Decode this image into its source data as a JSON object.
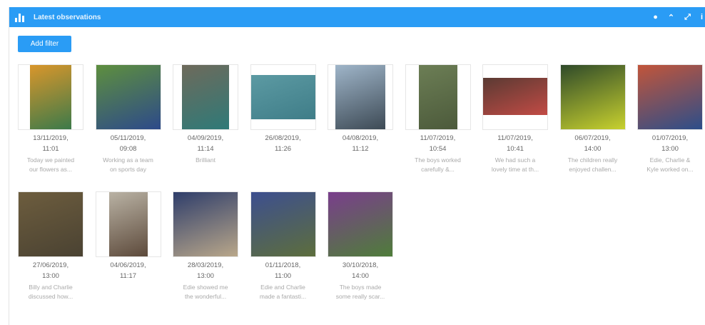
{
  "widget": {
    "title": "Latest observations",
    "icon": "bar-chart-icon",
    "tools": [
      {
        "name": "settings-icon",
        "glyph": "●"
      },
      {
        "name": "collapse-icon",
        "glyph": "⌃"
      },
      {
        "name": "expand-icon",
        "glyph": "⤢"
      },
      {
        "name": "info-icon",
        "glyph": "i"
      }
    ]
  },
  "filter_button": "Add filter",
  "observations": [
    {
      "date": "13/11/2019,",
      "time": "11:01",
      "caption": [
        "Today we painted",
        "our flowers as..."
      ],
      "colors": [
        "#d9962b",
        "#3c7a4a"
      ]
    },
    {
      "date": "05/11/2019,",
      "time": "09:08",
      "caption": [
        "Working as a team",
        "on sports day"
      ],
      "colors": [
        "#5e8f3e",
        "#2d4a8a"
      ]
    },
    {
      "date": "04/09/2019,",
      "time": "11:14",
      "caption": [
        "Brilliant"
      ],
      "colors": [
        "#6e6a5b",
        "#2f7a78"
      ]
    },
    {
      "date": "26/08/2019,",
      "time": "11:26",
      "caption": [],
      "colors": [
        "#5c9aa3",
        "#3f7d88"
      ]
    },
    {
      "date": "04/08/2019,",
      "time": "11:12",
      "caption": [],
      "colors": [
        "#9fb5c9",
        "#3d4a55"
      ]
    },
    {
      "date": "11/07/2019,",
      "time": "10:54",
      "caption": [
        "The boys worked",
        "carefully &..."
      ],
      "colors": [
        "#6c7e55",
        "#4c5a3b"
      ]
    },
    {
      "date": "11/07/2019,",
      "time": "10:41",
      "caption": [
        "We had such a",
        "lovely time at th..."
      ],
      "colors": [
        "#5a3a33",
        "#c24b45"
      ]
    },
    {
      "date": "06/07/2019,",
      "time": "14:00",
      "caption": [
        "The children really",
        "enjoyed challen..."
      ],
      "colors": [
        "#2f4a2a",
        "#c8d12e"
      ]
    },
    {
      "date": "01/07/2019,",
      "time": "13:00",
      "caption": [
        "Edie, Charlie &",
        "Kyle worked on..."
      ],
      "colors": [
        "#c2553a",
        "#2c4e8a"
      ]
    },
    {
      "date": "27/06/2019,",
      "time": "13:00",
      "caption": [
        "Billy and Charlie",
        "discussed how..."
      ],
      "colors": [
        "#6d5d3e",
        "#4a4232"
      ]
    },
    {
      "date": "04/06/2019,",
      "time": "11:17",
      "caption": [],
      "colors": [
        "#b9b2a4",
        "#5d4a3b"
      ]
    },
    {
      "date": "28/03/2019,",
      "time": "13:00",
      "caption": [
        "Edie showed me",
        "the wonderful..."
      ],
      "colors": [
        "#2f3e6b",
        "#b9a78a"
      ]
    },
    {
      "date": "01/11/2018,",
      "time": "11:00",
      "caption": [
        "Edie and Charlie",
        "made a fantasti..."
      ],
      "colors": [
        "#3d4f8f",
        "#5d6e3c"
      ]
    },
    {
      "date": "30/10/2018,",
      "time": "14:00",
      "caption": [
        "The boys made",
        "some really scar..."
      ],
      "colors": [
        "#7a3e8c",
        "#4f7d3a"
      ]
    }
  ]
}
